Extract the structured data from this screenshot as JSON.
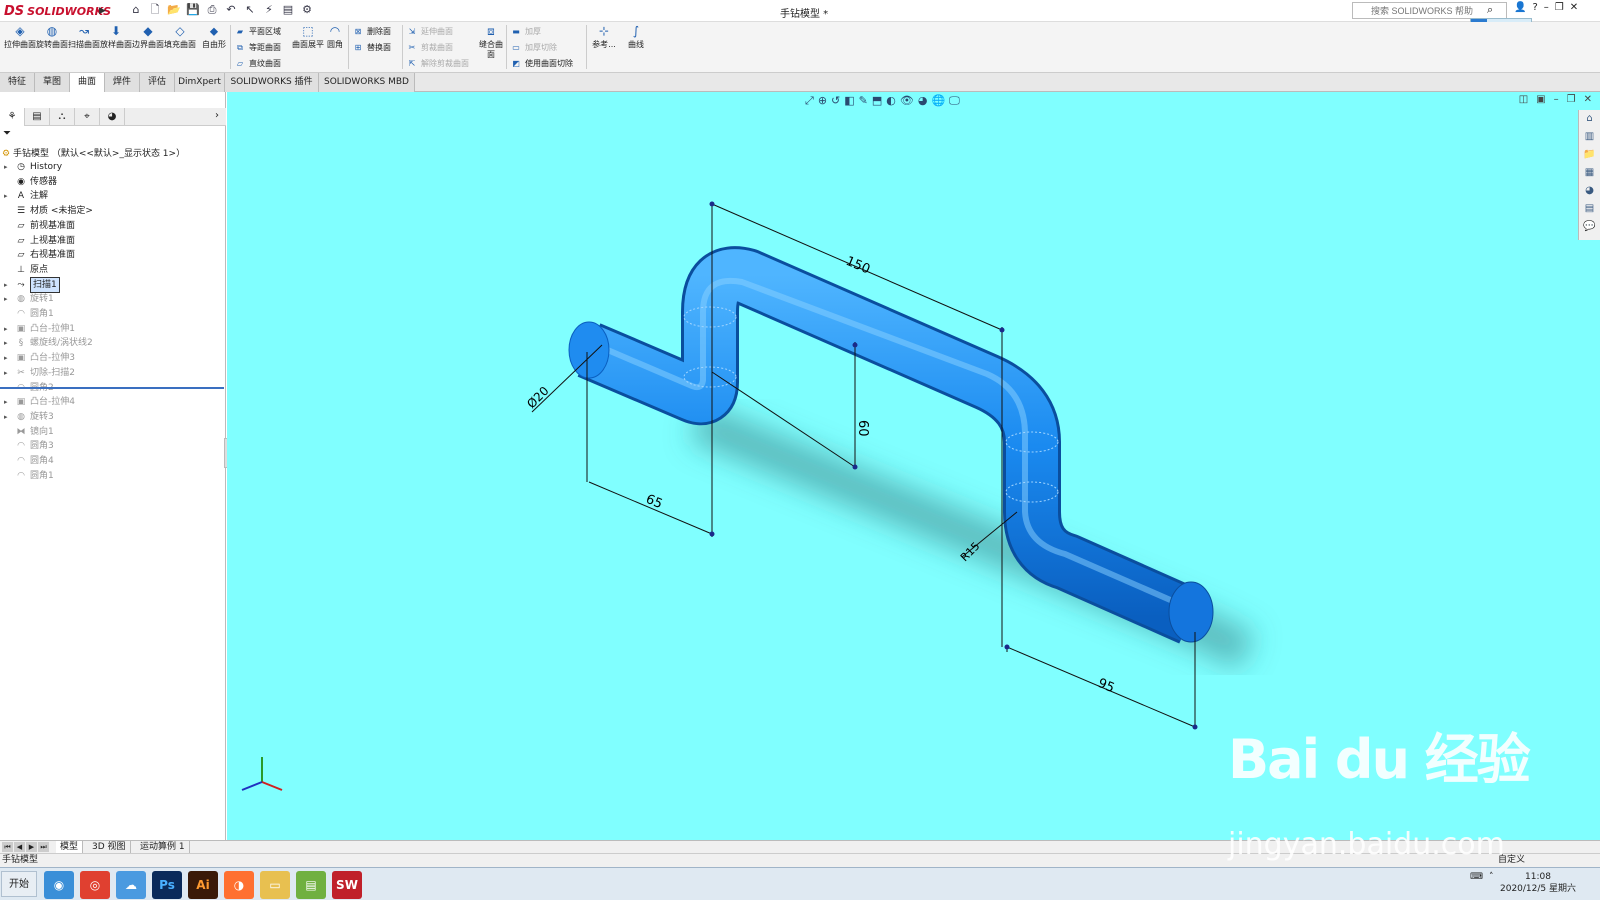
{
  "app": {
    "brand": "SOLIDWORKS",
    "ds": "DS",
    "document_title": "手钻模型 *"
  },
  "search": {
    "placeholder": "搜索 SOLIDWORKS 帮助"
  },
  "ribbon": {
    "big_buttons": [
      "拉伸曲面",
      "旋转曲面",
      "扫描曲面",
      "放样曲面",
      "边界曲面",
      "填充曲面",
      "自由形"
    ],
    "group1": [
      "平面区域",
      "等距曲面",
      "直纹曲面"
    ],
    "flatten": "曲面展平",
    "fillet": "圆角",
    "group2": [
      "删除面",
      "替换面"
    ],
    "group3": [
      "延伸曲面",
      "剪裁曲面",
      "解除剪裁曲面"
    ],
    "knit": "缝合曲面",
    "group4": [
      "加厚",
      "加厚切除",
      "使用曲面切除"
    ],
    "ref": "参考...",
    "curves": "曲线"
  },
  "tabs": [
    "特征",
    "草图",
    "曲面",
    "焊件",
    "评估",
    "DimXpert",
    "SOLIDWORKS 插件",
    "SOLIDWORKS MBD"
  ],
  "active_tab": "曲面",
  "tree": {
    "root": "手钻模型 （默认<<默认>_显示状态 1>）",
    "items": [
      {
        "label": "History",
        "icon": "history-icon",
        "expand": true,
        "suppressed": false
      },
      {
        "label": "传感器",
        "icon": "sensor-icon",
        "expand": false,
        "suppressed": false
      },
      {
        "label": "注解",
        "icon": "annotation-icon",
        "expand": true,
        "suppressed": false
      },
      {
        "label": "材质 <未指定>",
        "icon": "material-icon",
        "expand": false,
        "suppressed": false
      },
      {
        "label": "前视基准面",
        "icon": "plane-icon",
        "expand": false,
        "suppressed": false
      },
      {
        "label": "上视基准面",
        "icon": "plane-icon",
        "expand": false,
        "suppressed": false
      },
      {
        "label": "右视基准面",
        "icon": "plane-icon",
        "expand": false,
        "suppressed": false
      },
      {
        "label": "原点",
        "icon": "origin-icon",
        "expand": false,
        "suppressed": false
      },
      {
        "label": "扫描1",
        "icon": "sweep-icon",
        "expand": true,
        "suppressed": false,
        "selected": true
      },
      {
        "label": "旋转1",
        "icon": "revolve-icon",
        "expand": true,
        "suppressed": true
      },
      {
        "label": "圆角1",
        "icon": "fillet-icon",
        "expand": false,
        "suppressed": true
      },
      {
        "label": "凸台-拉伸1",
        "icon": "extrude-icon",
        "expand": true,
        "suppressed": true
      },
      {
        "label": "螺旋线/涡状线2",
        "icon": "helix-icon",
        "expand": true,
        "suppressed": true
      },
      {
        "label": "凸台-拉伸3",
        "icon": "extrude-icon",
        "expand": true,
        "suppressed": true
      },
      {
        "label": "切除-扫描2",
        "icon": "cut-icon",
        "expand": true,
        "suppressed": true
      },
      {
        "label": "圆角2",
        "icon": "fillet-icon",
        "expand": false,
        "suppressed": true
      },
      {
        "label": "凸台-拉伸4",
        "icon": "extrude-icon",
        "expand": true,
        "suppressed": true
      },
      {
        "label": "旋转3",
        "icon": "revolve-icon",
        "expand": true,
        "suppressed": true
      },
      {
        "label": "镜向1",
        "icon": "mirror-icon",
        "expand": false,
        "suppressed": true
      },
      {
        "label": "圆角3",
        "icon": "fillet-icon",
        "expand": false,
        "suppressed": true
      },
      {
        "label": "圆角4",
        "icon": "fillet-icon",
        "expand": false,
        "suppressed": true
      },
      {
        "label": "圆角1",
        "icon": "fillet-icon",
        "expand": false,
        "suppressed": true
      }
    ]
  },
  "dimensions": {
    "d1": "150",
    "d2": "60",
    "d3": "65",
    "d4": "95",
    "dia": "Ø20",
    "radius": "R15"
  },
  "bottom_tabs": [
    "模型",
    "3D 视图",
    "运动算例 1"
  ],
  "active_bottom_tab": "模型",
  "status": {
    "text": "手钻模型",
    "units": "自定义"
  },
  "taskbar": {
    "start": "开始",
    "apps": [
      "Ps",
      "Ai",
      "SW"
    ]
  },
  "clock": {
    "time": "11:08",
    "date": "2020/12/5 星期六"
  },
  "watermark": {
    "main": "Bai du 经验",
    "url": "jingyan.baidu.com"
  },
  "colors": {
    "viewport_bg": "#80ffff",
    "pipe": "#1a8af0",
    "accent": "#c8102e"
  }
}
